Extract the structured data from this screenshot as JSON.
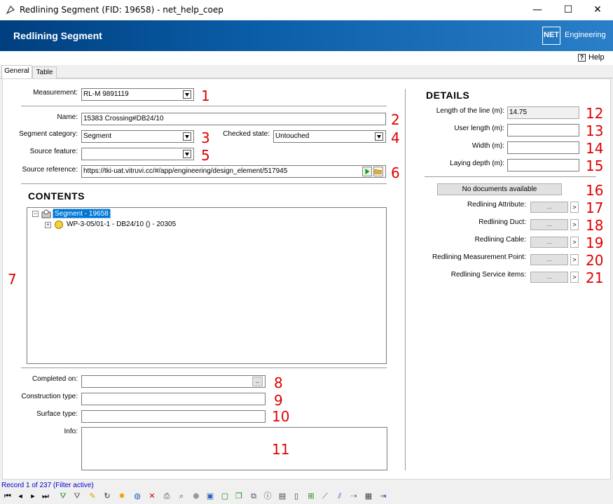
{
  "window": {
    "title": "Redlining Segment (FID: 19658) - net_help_coep",
    "minimize": "—",
    "maximize": "☐",
    "close": "✕"
  },
  "header": {
    "title": "Redlining Segment",
    "logo_text": "NET",
    "logo_sub": "Engineering"
  },
  "help": {
    "label": "Help",
    "icon": "?"
  },
  "tabs": [
    {
      "label": "General"
    },
    {
      "label": "Table"
    }
  ],
  "form": {
    "measurement": {
      "label": "Measurement:",
      "value": "RL-M 9891119",
      "marker": "1"
    },
    "name": {
      "label": "Name:",
      "value": "15383 Crossing#DB24/10",
      "marker": "2"
    },
    "segment_category": {
      "label": "Segment category:",
      "value": "Segment",
      "marker": "3"
    },
    "checked_state": {
      "label": "Checked state:",
      "value": "Untouched",
      "marker": "4"
    },
    "source_feature": {
      "label": "Source feature:",
      "value": "",
      "marker": "5"
    },
    "source_reference": {
      "label": "Source reference:",
      "value": "https://tki-uat.vitruvi.cc/#/app/engineering/design_element/517945",
      "marker": "6"
    },
    "contents_title": "CONTENTS",
    "contents_marker": "7",
    "tree": [
      {
        "label": "Segment - 19658",
        "expander": "⊟"
      },
      {
        "label": "WP-3-05/01-1 - DB24/10 () - 20305",
        "expander": "⊞"
      }
    ],
    "completed_on": {
      "label": "Completed on:",
      "value": "",
      "marker": "8",
      "btn": ".."
    },
    "construction_type": {
      "label": "Construction type:",
      "value": "",
      "marker": "9"
    },
    "surface_type": {
      "label": "Surface type:",
      "value": "",
      "marker": "10"
    },
    "info": {
      "label": "Info:",
      "value": "",
      "marker": "11"
    }
  },
  "details": {
    "title": "DETAILS",
    "length_line": {
      "label": "Length of the line (m):",
      "value": "14.75",
      "marker": "12"
    },
    "user_length": {
      "label": "User length (m):",
      "value": "",
      "marker": "13"
    },
    "width": {
      "label": "Width (m):",
      "value": "",
      "marker": "14"
    },
    "laying_depth": {
      "label": "Laying depth (m):",
      "value": "",
      "marker": "15"
    },
    "no_documents": {
      "label": "No documents available",
      "marker": "16"
    },
    "links": [
      {
        "label": "Redlining Attribute:",
        "dots": "...",
        "arrow": ">",
        "marker": "17"
      },
      {
        "label": "Redlining Duct:",
        "dots": "...",
        "arrow": ">",
        "marker": "18"
      },
      {
        "label": "Redlining Cable:",
        "dots": "...",
        "arrow": ">",
        "marker": "19"
      },
      {
        "label": "Redlining Measurement Point:",
        "dots": "...",
        "arrow": ">",
        "marker": "20"
      },
      {
        "label": "Redlining Service items:",
        "dots": "...",
        "arrow": ">",
        "marker": "21"
      }
    ]
  },
  "status": {
    "record": "Record 1 of 237 (Filter active)"
  },
  "toolbar_icons": [
    "first-record-icon",
    "prev-record-icon",
    "next-record-icon",
    "last-record-icon",
    "add-filter-icon",
    "filter-icon",
    "edit-icon",
    "refresh-icon",
    "highlight-icon",
    "globe-icon",
    "delete-icon",
    "print-icon",
    "zoom-select-icon",
    "zoom-icon",
    "select-icon",
    "copy-icon",
    "duplicate-icon",
    "merge-icon",
    "info-icon",
    "report-icon",
    "document-icon",
    "add-object-icon",
    "line-tool-icon",
    "split-icon",
    "connect-icon",
    "table-icon",
    "exit-icon"
  ],
  "colors": {
    "header_start": "#003f7f",
    "marker_red": "#e00000",
    "selection_blue": "#0078d7"
  }
}
